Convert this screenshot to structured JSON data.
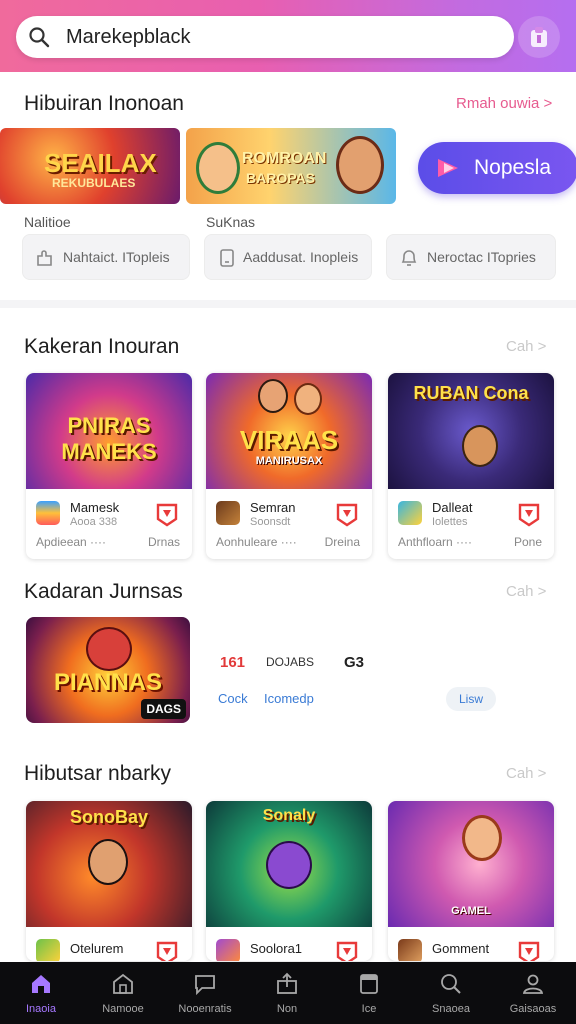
{
  "search": {
    "value": "Marekepblack"
  },
  "section1": {
    "title": "Hibuiran Inonoan",
    "more": "Rmah ouwia >"
  },
  "banners": [
    {
      "title": "SEAILAX",
      "subtitle": "REKUBULAES"
    },
    {
      "title": "ROMROAN",
      "subtitle": "BAROPAS"
    }
  ],
  "promo": {
    "label": "Nopesla"
  },
  "labels": {
    "left": "Nalitioe",
    "mid": "SuKnas"
  },
  "chips": [
    {
      "label": "Nahtaict. ITopleis",
      "icon": "puzzle-icon"
    },
    {
      "label": "Aaddusat. Inopleis",
      "icon": "device-icon"
    },
    {
      "label": "Neroctac ITopries",
      "icon": "bell-icon"
    }
  ],
  "section2": {
    "title": "Kakeran Inouran",
    "more": "Cah >",
    "cards": [
      {
        "art": "PNIRAS MANEKS",
        "name": "Mamesk",
        "sub": "Aooa 338",
        "left": "Apdieean ····",
        "right": "Drnas"
      },
      {
        "art": "VIRAAS",
        "art2": "MANIRUSAX",
        "name": "Semran",
        "sub": "Soonsdt",
        "left": "Aonhuleare ····",
        "right": "Dreina"
      },
      {
        "art": "RUBAN Cona",
        "name": "Dalleat",
        "sub": "Iolettes",
        "left": "Anthfloarn ····",
        "right": "Pone"
      }
    ]
  },
  "section3": {
    "title": "Kadaran Jurnsas",
    "more": "Cah >",
    "featured": {
      "art": "PIANNAS",
      "tag": "DAGS",
      "num1": "161",
      "label": "DOJABS",
      "num2": "G3",
      "link1": "Cock",
      "link2": "Icomedp",
      "button": "Lisw"
    }
  },
  "section4": {
    "title": "Hibutsar nbarky",
    "more": "Cah >",
    "cards": [
      {
        "art": "SonoBay",
        "name": "Otelurem"
      },
      {
        "art": "Sonaly",
        "name": "Soolora1"
      },
      {
        "art": "GAMEL",
        "name": "Gomment"
      }
    ]
  },
  "nav": [
    {
      "label": "Inaoia",
      "icon": "home-icon",
      "active": true
    },
    {
      "label": "Namooe",
      "icon": "store-icon"
    },
    {
      "label": "Nooenratis",
      "icon": "chat-icon"
    },
    {
      "label": "Non",
      "icon": "upload-icon"
    },
    {
      "label": "Ice",
      "icon": "file-icon"
    },
    {
      "label": "Snaoea",
      "icon": "search-icon"
    },
    {
      "label": "Gaisaoas",
      "icon": "profile-icon"
    }
  ]
}
